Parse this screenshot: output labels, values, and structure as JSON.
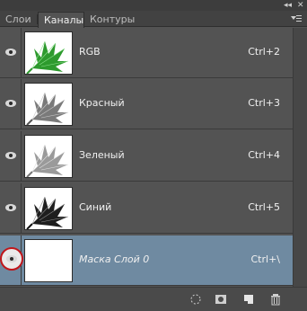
{
  "window": {
    "collapse_icon": "double-chevron-icon",
    "close_icon": "close-icon"
  },
  "tabs": [
    {
      "label": "Слои",
      "active": false
    },
    {
      "label": "Каналы",
      "active": true
    },
    {
      "label": "Контуры",
      "active": false
    }
  ],
  "panel_menu_icon": "panel-menu-icon",
  "channels": [
    {
      "name": "RGB",
      "shortcut": "Ctrl+2",
      "thumb": "color",
      "visible": true,
      "selected": false
    },
    {
      "name": "Красный",
      "shortcut": "Ctrl+3",
      "thumb": "red",
      "visible": true,
      "selected": false
    },
    {
      "name": "Зеленый",
      "shortcut": "Ctrl+4",
      "thumb": "green",
      "visible": true,
      "selected": false
    },
    {
      "name": "Синий",
      "shortcut": "Ctrl+5",
      "thumb": "blue",
      "visible": true,
      "selected": false
    },
    {
      "name": "Маска Слой 0",
      "shortcut": "Ctrl+\\",
      "thumb": "mask",
      "visible": true,
      "selected": true,
      "highlighted_eye": true
    }
  ],
  "colors": {
    "selected_row": "#6f8aa1",
    "highlight_circle": "#c0161b",
    "leaf_green": "#2a8a2a"
  },
  "bottom_icons": [
    "load-channel-selection-icon",
    "save-selection-as-channel-icon",
    "new-channel-icon",
    "delete-channel-icon"
  ]
}
